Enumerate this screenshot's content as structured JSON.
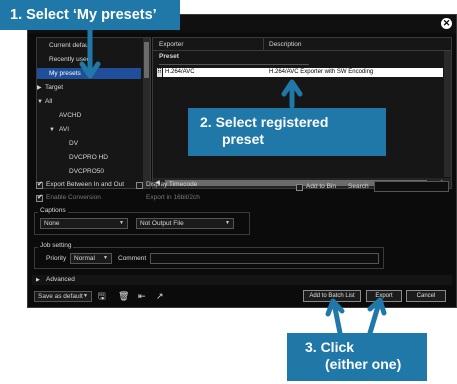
{
  "callouts": {
    "step1": "1.  Select ‘My presets’",
    "step2": [
      "2.  Select registered",
      "preset"
    ],
    "step3": [
      "3.  Click",
      "(either one)"
    ]
  },
  "tree": {
    "items": [
      {
        "label": "Current default",
        "arrow": ""
      },
      {
        "label": "Recently used",
        "arrow": ""
      },
      {
        "label": "My presets",
        "arrow": "",
        "selected": true
      },
      {
        "label": "Target",
        "arrow": "▶"
      },
      {
        "label": "All",
        "arrow": "▼"
      },
      {
        "label": "AVCHD",
        "arrow": ""
      },
      {
        "label": "AVI",
        "arrow": "▼"
      },
      {
        "label": "DV",
        "arrow": ""
      },
      {
        "label": "DVCPRO HD",
        "arrow": ""
      },
      {
        "label": "DVCPRO50",
        "arrow": ""
      }
    ]
  },
  "grid": {
    "col_exporter": "Exporter",
    "col_description": "Description",
    "section": "Preset",
    "row_exporter": "H.264/AVC",
    "row_description": "H.264/AVC Exporter with SW Encoding"
  },
  "options": {
    "export_in_out": "Export Between In and Out",
    "display_timecode": "Display Timecode",
    "add_to_bin": "Add to Bin",
    "search_label": "Search",
    "enable_conversion": "Enable Conversion",
    "export_16bit": "Export in 16bit/2ch"
  },
  "captions": {
    "label": "Captions",
    "combo1": "None",
    "combo2": "Not Output File"
  },
  "job": {
    "label": "Job setting",
    "priority_label": "Priority",
    "priority_value": "Normal",
    "comment_label": "Comment"
  },
  "advanced": "Advanced",
  "footer": {
    "save_default": "Save as default",
    "add_batch": "Add to Batch List",
    "export": "Export",
    "cancel": "Cancel"
  },
  "colors": {
    "callout": "#1f78a8",
    "selection": "#1f4f9a",
    "window_bg": "#0b0b0b"
  }
}
